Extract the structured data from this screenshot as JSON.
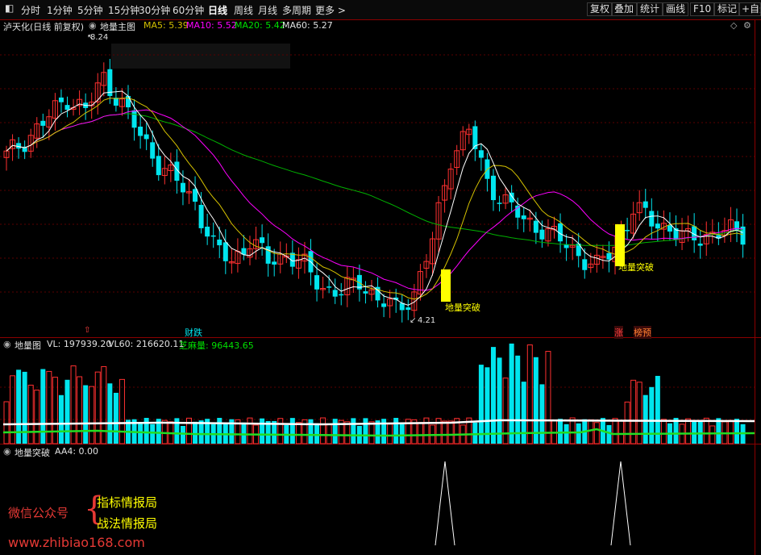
{
  "toolbar": {
    "periods": [
      "分时",
      "1分钟",
      "5分钟",
      "15分钟",
      "30分钟",
      "60分钟",
      "日线",
      "周线",
      "月线",
      "多周期",
      "更多 >"
    ],
    "active_period": "日线",
    "right_buttons": [
      "复权",
      "叠加",
      "统计",
      "画线",
      "F10",
      "标记",
      "+自选"
    ]
  },
  "main_panel": {
    "stock_name": "泸天化(日线 前复权)",
    "indicator_name": "地量主图",
    "ma5": "MA5: 5.39",
    "ma10": "MA10: 5.52",
    "ma20": "MA20: 5.42",
    "ma60": "MA60: 5.27",
    "high_label": "8.24",
    "low_label": "4.21",
    "signal_label_1": "地量突破",
    "signal_label_2": "地量突破",
    "bottom_tag_1": "财跌",
    "bottom_tag_2": "涨",
    "bottom_tag_3": "榜预"
  },
  "volume_panel": {
    "indicator_name": "地量图",
    "vl": "VL: 197939.20",
    "vl60": "VL60: 216620.11",
    "zhima": "芝麻量: 96443.65"
  },
  "signal_panel": {
    "indicator_name": "地量突破",
    "aa4": "AA4: 0.00"
  },
  "watermark": {
    "wechat": "微信公众号",
    "brace": "{",
    "line1": "指标情报局",
    "line2": "战法情报局",
    "url": "www.zhibiao168.com"
  },
  "colors": {
    "up": "#ff3030",
    "down": "#00e5ee",
    "ma5": "#ffffff",
    "ma10": "#ff00ff",
    "ma20": "#d4c000",
    "ma60": "#00b000",
    "signal": "#ffff00"
  }
}
